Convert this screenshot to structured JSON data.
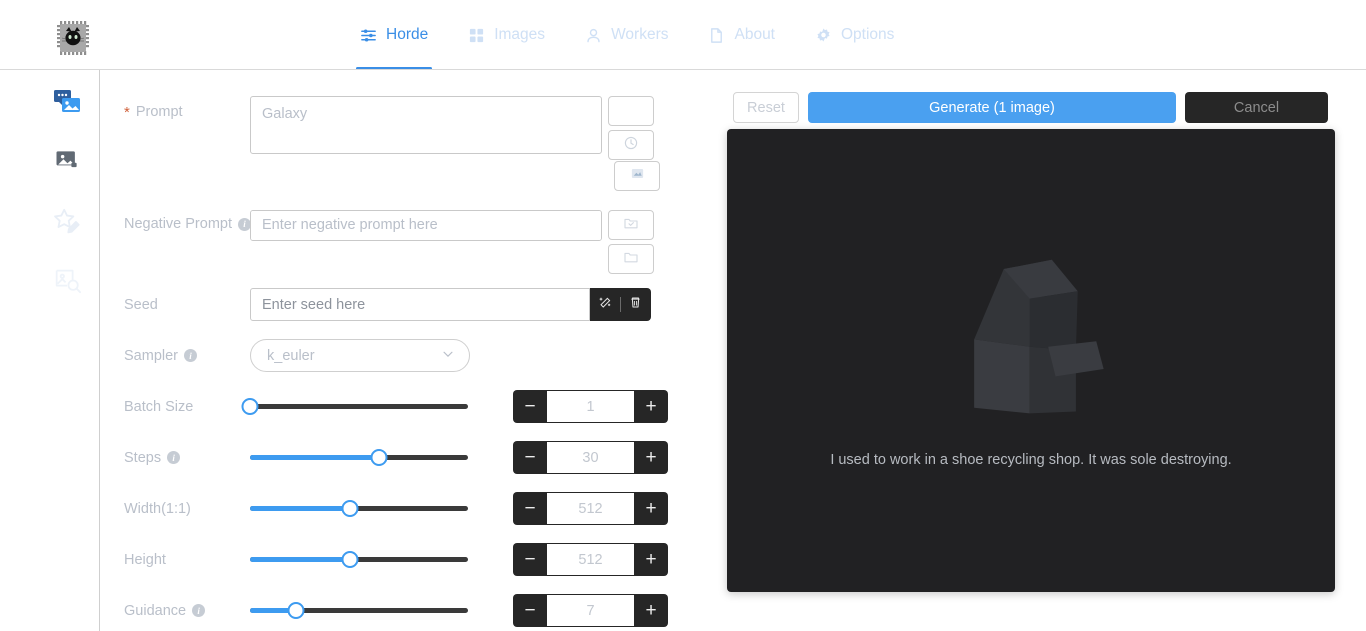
{
  "app": {
    "logo_icon": "cat-chip-logo",
    "accent": "#3d9bf0",
    "panel_bg": "#212123"
  },
  "nav": {
    "tabs": [
      {
        "label": "Horde",
        "icon": "sliders-icon",
        "active": true
      },
      {
        "label": "Images",
        "icon": "grid-icon",
        "active": false
      },
      {
        "label": "Workers",
        "icon": "person-icon",
        "active": false
      },
      {
        "label": "About",
        "icon": "document-icon",
        "active": false
      },
      {
        "label": "Options",
        "icon": "gear-icon",
        "active": false
      }
    ]
  },
  "sidebar": {
    "items": [
      {
        "name": "text-to-image",
        "icon": "text-to-image-icon",
        "active": true
      },
      {
        "name": "image-to-image",
        "icon": "image-to-image-icon",
        "active": false
      },
      {
        "name": "inpainting",
        "icon": "star-pencil-icon",
        "active": false
      },
      {
        "name": "interrogate",
        "icon": "image-search-icon",
        "active": false
      }
    ]
  },
  "form": {
    "prompt": {
      "label": "Prompt",
      "required_mark": "*",
      "placeholder": "Galaxy",
      "value": ""
    },
    "prompt_buttons": [
      {
        "name": "prompt-blank-button",
        "icon": "blank-icon"
      },
      {
        "name": "prompt-history-button",
        "icon": "clock-icon"
      },
      {
        "name": "prompt-image-button",
        "icon": "image-chart-icon"
      }
    ],
    "negative_prompt": {
      "label": "Negative Prompt",
      "placeholder": "Enter negative prompt here",
      "value": "",
      "info": true
    },
    "negative_buttons": [
      {
        "name": "save-preset-button",
        "icon": "folder-check-icon"
      },
      {
        "name": "load-preset-button",
        "icon": "folder-icon"
      }
    ],
    "seed": {
      "label": "Seed",
      "placeholder": "Enter seed here",
      "value": "",
      "actions": [
        {
          "name": "randomize-seed-button",
          "icon": "magic-wand-icon"
        },
        {
          "name": "clear-seed-button",
          "icon": "trash-icon"
        }
      ]
    },
    "sampler": {
      "label": "Sampler",
      "value": "k_euler",
      "info": true,
      "chevron": "chevron-down-icon"
    },
    "sliders": [
      {
        "label": "Batch Size",
        "value": "1",
        "percent": 0,
        "info": false
      },
      {
        "label": "Steps",
        "value": "30",
        "percent": 59,
        "info": true
      },
      {
        "label": "Width(1:1)",
        "value": "512",
        "percent": 46,
        "info": false
      },
      {
        "label": "Height",
        "value": "512",
        "percent": 46,
        "info": false
      },
      {
        "label": "Guidance",
        "value": "7",
        "percent": 21,
        "info": true
      }
    ],
    "stepper": {
      "minus": "−",
      "plus": "+"
    }
  },
  "actions": {
    "reset": "Reset",
    "generate": "Generate (1 image)",
    "cancel": "Cancel"
  },
  "canvas": {
    "empty_icon": "open-box-icon",
    "empty_text": "I used to work in a shoe recycling shop. It was sole destroying."
  }
}
